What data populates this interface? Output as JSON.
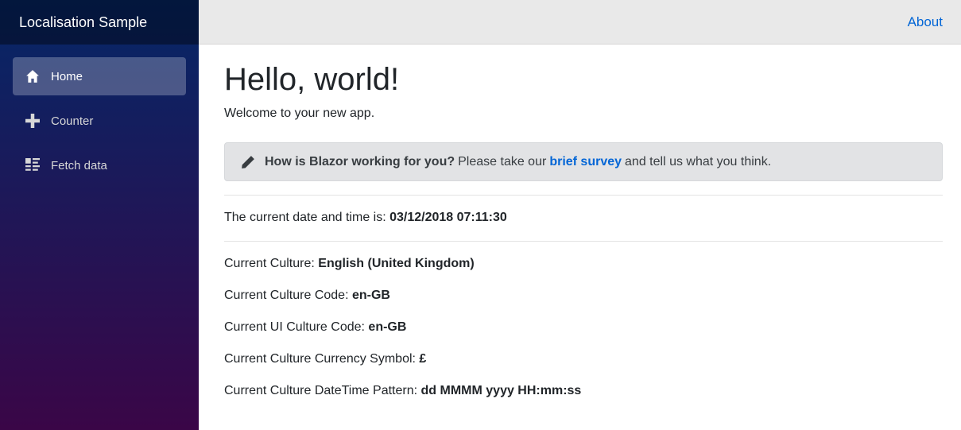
{
  "sidebar": {
    "brand": "Localisation Sample",
    "items": [
      {
        "label": "Home",
        "icon": "home-icon",
        "active": true
      },
      {
        "label": "Counter",
        "icon": "plus-icon",
        "active": false
      },
      {
        "label": "Fetch data",
        "icon": "list-rich-icon",
        "active": false
      }
    ]
  },
  "topbar": {
    "about_label": "About"
  },
  "main": {
    "title": "Hello, world!",
    "welcome": "Welcome to your new app.",
    "survey": {
      "icon": "pencil-icon",
      "question": "How is Blazor working for you?",
      "before_link": "Please take our",
      "link_text": "brief survey",
      "after_link": "and tell us what you think."
    },
    "datetime": {
      "label": "The current date and time is:",
      "value": "03/12/2018 07:11:30"
    },
    "culture": [
      {
        "label": "Current Culture:",
        "value": "English (United Kingdom)"
      },
      {
        "label": "Current Culture Code:",
        "value": "en-GB"
      },
      {
        "label": "Current UI Culture Code:",
        "value": "en-GB"
      },
      {
        "label": "Current Culture Currency Symbol:",
        "value": "£"
      },
      {
        "label": "Current Culture DateTime Pattern:",
        "value": "dd MMMM yyyy HH:mm:ss"
      }
    ]
  },
  "colors": {
    "sidebar_top": "#052767",
    "sidebar_bottom": "#3a0647",
    "link": "#0366d6",
    "topbar_bg": "#e9e9e9"
  }
}
